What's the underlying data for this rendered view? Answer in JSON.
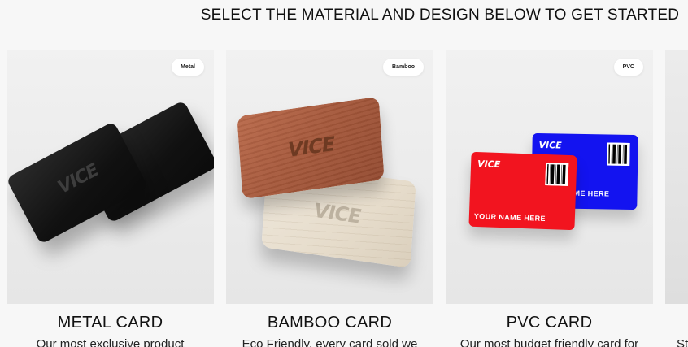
{
  "headline": "SELECT THE MATERIAL AND DESIGN BELOW TO GET STARTED",
  "cards": [
    {
      "badge": "Metal",
      "title": "METAL CARD",
      "desc": "Our most exclusive product",
      "logo": "VICE"
    },
    {
      "badge": "Bamboo",
      "title": "BAMBOO CARD",
      "desc": "Eco Friendly, every card sold we",
      "logo": "VICE"
    },
    {
      "badge": "PVC",
      "title": "PVC CARD",
      "desc": "Our most budget friendly card for",
      "logo": "VICE",
      "name_text_front": "YOUR NAME HERE",
      "name_text_back": "ME HERE"
    },
    {
      "desc": "St"
    }
  ]
}
